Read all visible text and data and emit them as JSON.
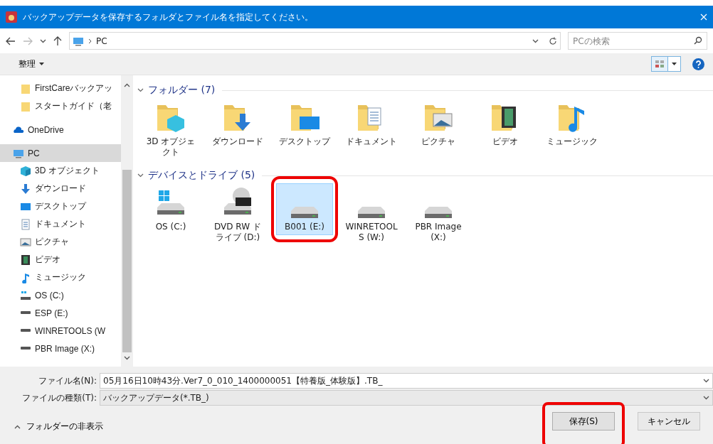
{
  "window": {
    "title": "バックアップデータを保存するフォルダとファイル名を指定してください。"
  },
  "nav": {
    "path": "PC",
    "search": {
      "placeholder": "PCの検索"
    }
  },
  "toolbar": {
    "organize": "整理"
  },
  "sidebar": {
    "pinned": [
      {
        "label": "FirstCareバックアッ",
        "selected": false
      },
      {
        "label": "スタートガイド（老",
        "selected": false
      }
    ],
    "items": [
      {
        "label": "OneDrive",
        "selected": false
      },
      {
        "label": "PC",
        "selected": true,
        "children": [
          {
            "label": "3D オブジェクト",
            "selected": false
          },
          {
            "label": "ダウンロード",
            "selected": false
          },
          {
            "label": "デスクトップ",
            "selected": false
          },
          {
            "label": "ドキュメント",
            "selected": false
          },
          {
            "label": "ピクチャ",
            "selected": false
          },
          {
            "label": "ビデオ",
            "selected": false
          },
          {
            "label": "ミュージック",
            "selected": false
          },
          {
            "label": "OS (C:)",
            "selected": false
          },
          {
            "label": "ESP (E:)",
            "selected": false
          },
          {
            "label": "WINRETOOLS (W",
            "selected": false
          },
          {
            "label": "PBR Image (X:)",
            "selected": false
          }
        ]
      }
    ]
  },
  "sections": [
    {
      "title": "フォルダー (7)",
      "expanded": true,
      "items": [
        {
          "label": "3D オブジェクト",
          "selected": false,
          "highlighted": false
        },
        {
          "label": "ダウンロード",
          "selected": false,
          "highlighted": false
        },
        {
          "label": "デスクトップ",
          "selected": false,
          "highlighted": false
        },
        {
          "label": "ドキュメント",
          "selected": false,
          "highlighted": false
        },
        {
          "label": "ピクチャ",
          "selected": false,
          "highlighted": false
        },
        {
          "label": "ビデオ",
          "selected": false,
          "highlighted": false
        },
        {
          "label": "ミュージック",
          "selected": false,
          "highlighted": false
        }
      ]
    },
    {
      "title": "デバイスとドライブ (5)",
      "expanded": true,
      "items": [
        {
          "label": "OS (C:)",
          "selected": false,
          "highlighted": false
        },
        {
          "label": "DVD RW ドライブ (D:)",
          "selected": false,
          "highlighted": false
        },
        {
          "label": "B001 (E:)",
          "selected": true,
          "highlighted": true
        },
        {
          "label": "WINRETOOLS (W:)",
          "selected": false,
          "highlighted": false
        },
        {
          "label": "PBR Image (X:)",
          "selected": false,
          "highlighted": false
        }
      ]
    }
  ],
  "form": {
    "filename": {
      "label": "ファイル名(N):",
      "value": "05月16日10時43分.Ver7_0_010_1400000051【特養版_体験版】.TB_"
    },
    "filetype": {
      "label": "ファイルの種類(T):",
      "value": "バックアップデータ(*.TB_)"
    }
  },
  "footer": {
    "toggle": "フォルダーの非表示",
    "buttons": [
      {
        "label": "保存(S)",
        "kind": "primary",
        "highlighted": true
      },
      {
        "label": "キャンセル",
        "kind": "cancel",
        "highlighted": false
      }
    ]
  }
}
